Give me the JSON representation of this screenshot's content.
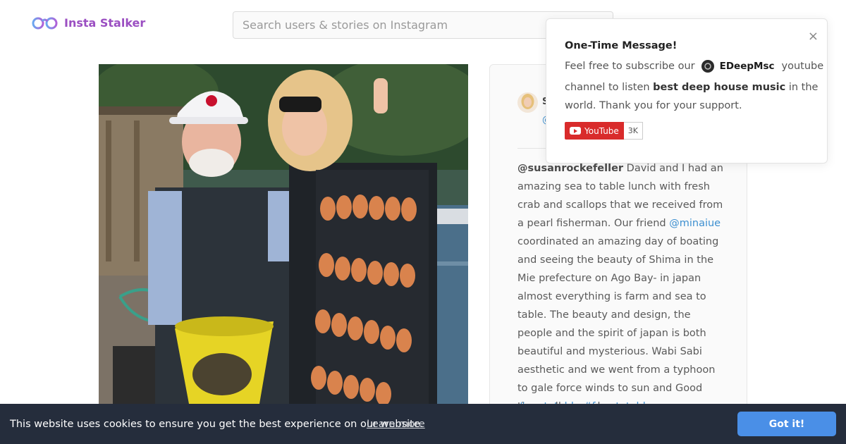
{
  "header": {
    "logo_text": "Insta Stalker",
    "search_placeholder": "Search users & stories on Instagram"
  },
  "post": {
    "user_initial": "S",
    "user_handle": "@",
    "caption_user": "@susanrockefeller",
    "caption_part1": " David and I had an amazing sea to table lunch with fresh crab and scallops that we received from a pearl fisherman. Our friend ",
    "caption_mention": "@minaiue",
    "caption_part2": " coordinated an amazing day of boating and seeing the beauty of Shima in the Mie prefecture on Ago Bay- in japan almost everything is farm and sea to table. The beauty and design, the people and the spirit of japan is both beautiful and mysterious. Wabi Sabi aesthetic and we went from a typhoon to gale force winds to sun and Good times all around.",
    "hashtags": "#seatotable #farmtotable"
  },
  "popup": {
    "title": "One-Time Message!",
    "text_before": "Feel free to subscribe our",
    "channel_name": "EDeepMsc",
    "text_after": "youtube",
    "line2_start": "channel to listen ",
    "line2_bold": "best deep house music",
    "line2_end": " in the world. Thank you for your support.",
    "close_glyph": "×",
    "youtube_label": "YouTube",
    "youtube_count": "3K"
  },
  "cookie": {
    "message": "This website uses cookies to ensure you get the best experience on our website.",
    "link": "Learn more",
    "button": "Got it!"
  },
  "colors": {
    "brand": "#9b4fc2",
    "link": "#3d8fd0",
    "cookie_bar": "#252d3c",
    "cookie_button": "#4a8fe7",
    "youtube_red": "#d92b2b"
  },
  "icons": [
    "binoculars-logo-icon",
    "channel-avatar-icon",
    "youtube-play-icon",
    "close-icon"
  ]
}
